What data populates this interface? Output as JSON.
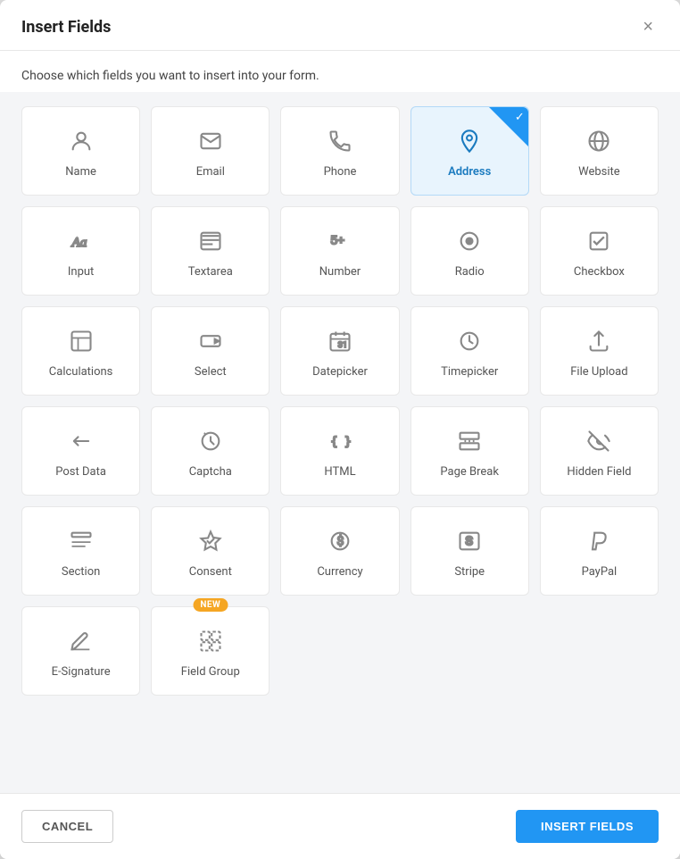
{
  "modal": {
    "title": "Insert Fields",
    "subtitle": "Choose which fields you want to insert into your form.",
    "close_label": "×"
  },
  "footer": {
    "cancel_label": "CANCEL",
    "insert_label": "INSERT FIELDS"
  },
  "fields": [
    {
      "id": "name",
      "label": "Name",
      "icon": "name",
      "selected": false
    },
    {
      "id": "email",
      "label": "Email",
      "icon": "email",
      "selected": false
    },
    {
      "id": "phone",
      "label": "Phone",
      "icon": "phone",
      "selected": false
    },
    {
      "id": "address",
      "label": "Address",
      "icon": "address",
      "selected": true
    },
    {
      "id": "website",
      "label": "Website",
      "icon": "website",
      "selected": false
    },
    {
      "id": "input",
      "label": "Input",
      "icon": "input",
      "selected": false
    },
    {
      "id": "textarea",
      "label": "Textarea",
      "icon": "textarea",
      "selected": false
    },
    {
      "id": "number",
      "label": "Number",
      "icon": "number",
      "selected": false
    },
    {
      "id": "radio",
      "label": "Radio",
      "icon": "radio",
      "selected": false
    },
    {
      "id": "checkbox",
      "label": "Checkbox",
      "icon": "checkbox",
      "selected": false
    },
    {
      "id": "calculations",
      "label": "Calculations",
      "icon": "calculations",
      "selected": false
    },
    {
      "id": "select",
      "label": "Select",
      "icon": "select",
      "selected": false
    },
    {
      "id": "datepicker",
      "label": "Datepicker",
      "icon": "datepicker",
      "selected": false
    },
    {
      "id": "timepicker",
      "label": "Timepicker",
      "icon": "timepicker",
      "selected": false
    },
    {
      "id": "fileupload",
      "label": "File Upload",
      "icon": "fileupload",
      "selected": false
    },
    {
      "id": "postdata",
      "label": "Post Data",
      "icon": "postdata",
      "selected": false
    },
    {
      "id": "captcha",
      "label": "Captcha",
      "icon": "captcha",
      "selected": false
    },
    {
      "id": "html",
      "label": "HTML",
      "icon": "html",
      "selected": false
    },
    {
      "id": "pagebreak",
      "label": "Page Break",
      "icon": "pagebreak",
      "selected": false
    },
    {
      "id": "hiddenfield",
      "label": "Hidden Field",
      "icon": "hiddenfield",
      "selected": false
    },
    {
      "id": "section",
      "label": "Section",
      "icon": "section",
      "selected": false
    },
    {
      "id": "consent",
      "label": "Consent",
      "icon": "consent",
      "selected": false
    },
    {
      "id": "currency",
      "label": "Currency",
      "icon": "currency",
      "selected": false
    },
    {
      "id": "stripe",
      "label": "Stripe",
      "icon": "stripe",
      "selected": false
    },
    {
      "id": "paypal",
      "label": "PayPal",
      "icon": "paypal",
      "selected": false
    },
    {
      "id": "esignature",
      "label": "E-Signature",
      "icon": "esignature",
      "selected": false,
      "new": false
    },
    {
      "id": "fieldgroup",
      "label": "Field Group",
      "icon": "fieldgroup",
      "selected": false,
      "new": true
    }
  ]
}
